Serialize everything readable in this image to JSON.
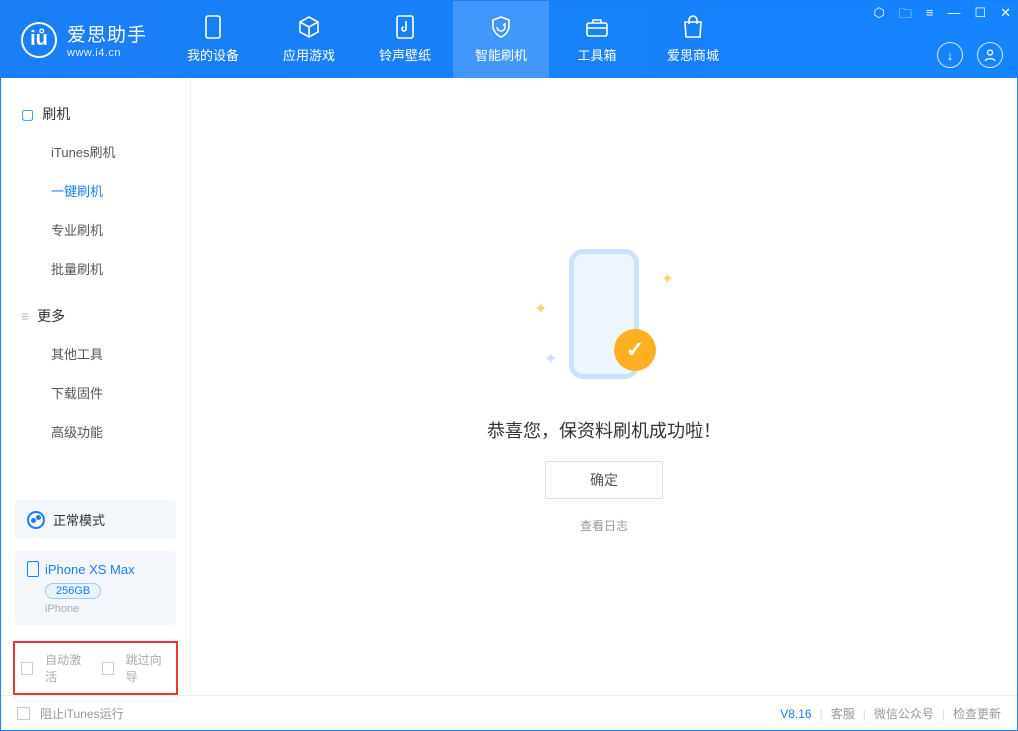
{
  "app": {
    "name": "爱思助手",
    "url": "www.i4.cn"
  },
  "tabs": [
    {
      "id": "device",
      "label": "我的设备"
    },
    {
      "id": "apps",
      "label": "应用游戏"
    },
    {
      "id": "ring",
      "label": "铃声壁纸"
    },
    {
      "id": "flash",
      "label": "智能刷机",
      "active": true
    },
    {
      "id": "tools",
      "label": "工具箱"
    },
    {
      "id": "mall",
      "label": "爱思商城"
    }
  ],
  "sidebar": {
    "group1": {
      "title": "刷机",
      "items": [
        "iTunes刷机",
        "一键刷机",
        "专业刷机",
        "批量刷机"
      ],
      "activeIndex": 1
    },
    "group2": {
      "title": "更多",
      "items": [
        "其他工具",
        "下载固件",
        "高级功能"
      ]
    }
  },
  "modeCard": {
    "label": "正常模式"
  },
  "deviceCard": {
    "name": "iPhone XS Max",
    "capacity": "256GB",
    "type": "iPhone"
  },
  "options": {
    "autoActivate": "自动激活",
    "skipGuide": "跳过向导"
  },
  "main": {
    "message": "恭喜您，保资料刷机成功啦！",
    "okButton": "确定",
    "viewLog": "查看日志"
  },
  "footer": {
    "blockItunes": "阻止iTunes运行",
    "version": "V8.16",
    "cs": "客服",
    "wechat": "微信公众号",
    "update": "检查更新"
  }
}
